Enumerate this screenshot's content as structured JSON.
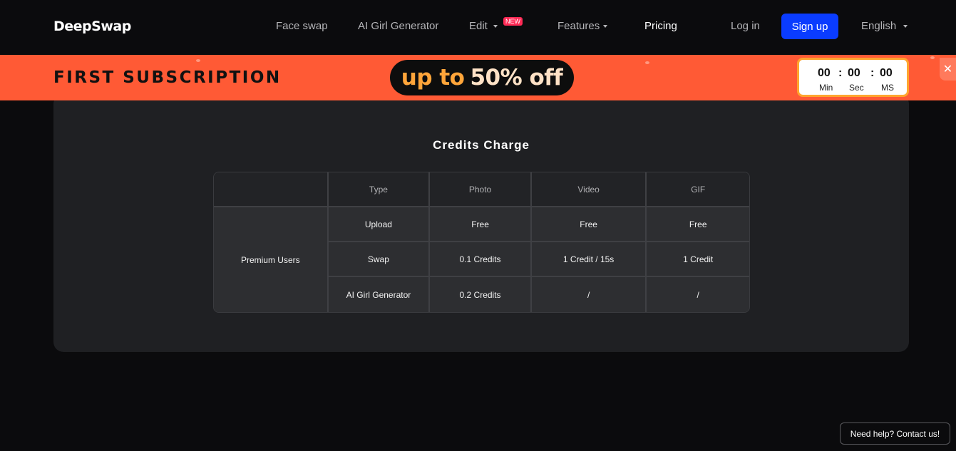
{
  "header": {
    "logo": "DeepSwap",
    "nav": {
      "face_swap": "Face swap",
      "ai_girl": "AI Girl Generator",
      "edit": "Edit",
      "new_badge": "NEW",
      "features": "Features",
      "pricing": "Pricing",
      "login": "Log in",
      "signup": "Sign up",
      "language": "English"
    }
  },
  "promo": {
    "title": "FIRST SUBSCRIPTION",
    "pill_part1": "up to",
    "pill_part2": "50% off",
    "timer": {
      "min": "00",
      "sec": "00",
      "ms": "00",
      "min_label": "Min",
      "sec_label": "Sec",
      "ms_label": "MS",
      "sep": ":"
    },
    "close": "✕",
    "colors": {
      "banner": "#ff5a35",
      "pill_accent": "#ffa53a",
      "timer_border": "#ffa52e"
    }
  },
  "credits": {
    "title": "Credits Charge",
    "headers": [
      "",
      "Type",
      "Photo",
      "Video",
      "GIF"
    ],
    "row_group": "Premium Users",
    "rows": [
      {
        "type": "Upload",
        "photo": "Free",
        "video": "Free",
        "gif": "Free"
      },
      {
        "type": "Swap",
        "photo": "0.1 Credits",
        "video": "1 Credit /  15s",
        "gif": "1 Credit"
      },
      {
        "type": "AI Girl Generator",
        "photo": "0.2 Credits",
        "video": "/",
        "gif": "/"
      }
    ]
  },
  "help": "Need help? Contact us!",
  "colors": {
    "signup": "#0a3cff",
    "background": "#0b0b0d",
    "card": "#1f2023"
  }
}
